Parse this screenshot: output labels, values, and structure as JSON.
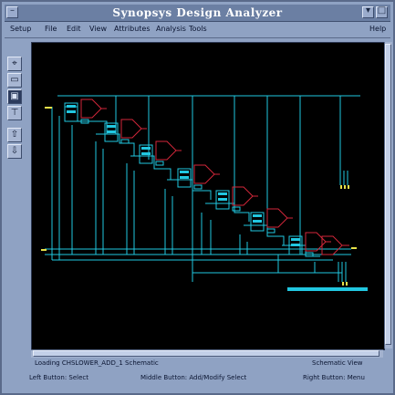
{
  "window": {
    "title": "Synopsys Design Analyzer",
    "help": "Help"
  },
  "menu": {
    "items": [
      "Setup",
      "File",
      "Edit",
      "View",
      "Attributes",
      "Analysis",
      "Tools"
    ]
  },
  "toolbar": {
    "icons": [
      "zoom-in-icon",
      "zoom-box-icon",
      "symbol-view-icon",
      "hierarchy-icon",
      "up-icon",
      "down-icon"
    ]
  },
  "status": {
    "message": "Loading CHSLOWER_ADD_1 Schematic",
    "view": "Schematic View",
    "left": "Left Button: Select",
    "middle": "Middle Button: Add/Modify Select",
    "right": "Right Button: Menu"
  },
  "colors": {
    "wire": "#21c7e0",
    "gate": "#d2263a",
    "pin": "#e8e24a",
    "canvas": "#000000",
    "window": "#8fa2c3"
  }
}
